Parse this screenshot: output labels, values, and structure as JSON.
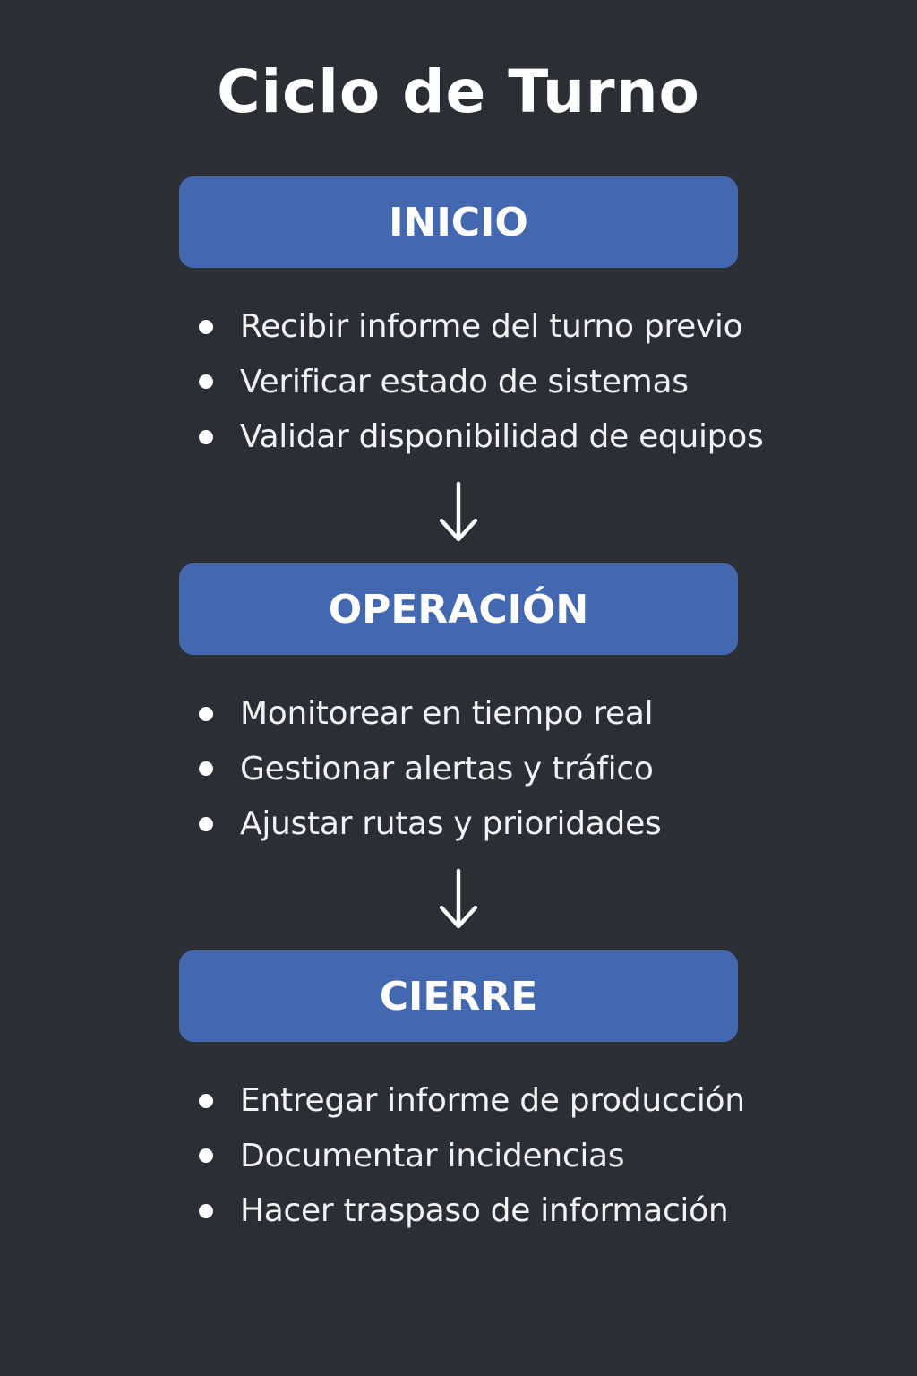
{
  "title": "Ciclo de Turno",
  "stages": [
    {
      "label": "INICIO",
      "items": [
        "Recibir informe del turno previo",
        "Verificar estado de sistemas",
        "Validar disponibilidad de equipos"
      ]
    },
    {
      "label": "OPERACIÓN",
      "items": [
        "Monitorear en tiempo real",
        "Gestionar alertas y tráfico",
        "Ajustar rutas y prioridades"
      ]
    },
    {
      "label": "CIERRE",
      "items": [
        "Entregar informe de producción",
        "Documentar incidencias",
        "Hacer traspaso de información"
      ]
    }
  ],
  "icons": {
    "bullet": "bullet-dot",
    "connector": "arrow-down-icon"
  },
  "colors": {
    "background": "#2b2e33",
    "stage_box": "#4368b0",
    "text": "#ffffff"
  }
}
